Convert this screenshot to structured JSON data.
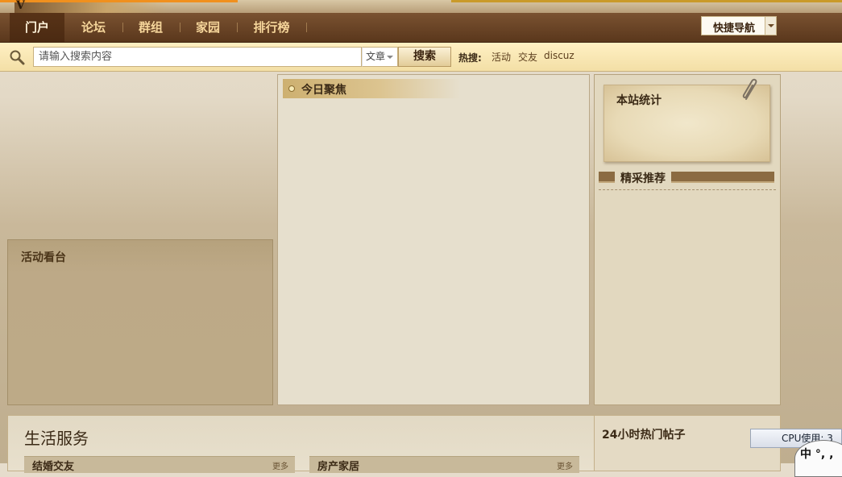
{
  "nav": {
    "items": [
      {
        "label": "门户",
        "active": true
      },
      {
        "label": "论坛",
        "active": false
      },
      {
        "label": "群组",
        "active": false
      },
      {
        "label": "家园",
        "active": false
      },
      {
        "label": "排行榜",
        "active": false
      }
    ],
    "quick_nav_label": "快捷导航"
  },
  "search": {
    "placeholder": "请输入搜索内容",
    "type_selected": "文章",
    "button_label": "搜索",
    "hot_label": "热搜:",
    "hot_links": [
      "活动",
      "交友",
      "discuz"
    ]
  },
  "panels": {
    "activity_title": "活动看台",
    "focus_title": "今日聚焦",
    "stats_title": "本站统计",
    "recommend_title": "精采推荐",
    "services_title": "生活服务",
    "services_sub": [
      {
        "label": "结婚交友",
        "more": "更多"
      },
      {
        "label": "房产家居",
        "more": "更多"
      }
    ],
    "hot_posts_title": "24小时热门帖子"
  },
  "overlays": {
    "cpu_text": "CPU使用: 3",
    "ime_text": "中 °, ,"
  },
  "colors": {
    "nav_bg": "#5a371c",
    "nav_text": "#f5d59a",
    "search_bg": "#f3dfa6",
    "accent_orange": "#f0901e"
  },
  "icons": {
    "search": "search-icon",
    "clip": "paperclip-icon",
    "dropdown": "chevron-down-icon"
  }
}
